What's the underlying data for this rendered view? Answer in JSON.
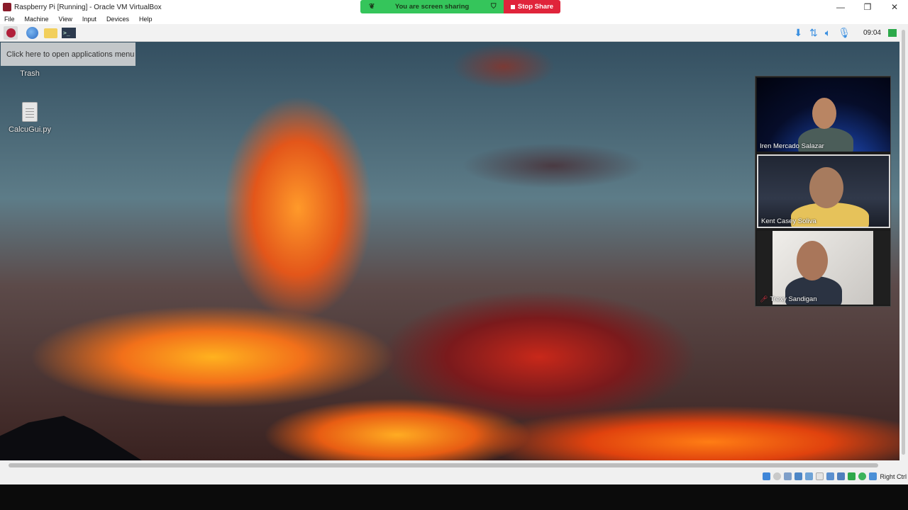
{
  "window": {
    "title": "Raspberry Pi [Running] - Oracle VM VirtualBox",
    "minimize": "—",
    "maximize": "❐",
    "close": "✕"
  },
  "menubar": {
    "items": [
      "File",
      "Machine",
      "View",
      "Input",
      "Devices",
      "Help"
    ]
  },
  "screen_share": {
    "status": "You are screen sharing",
    "stop_label": "Stop Share",
    "colors": {
      "share_bg": "#35c55b",
      "stop_bg": "#e0243b"
    }
  },
  "guest": {
    "taskbar": {
      "launchers": [
        "raspberry-menu-icon",
        "web-browser-icon",
        "file-manager-icon",
        "terminal-icon"
      ],
      "terminal_glyph": ">_",
      "clock": "09:04"
    },
    "tooltip": "Click here to open applications menu",
    "desktop_icons": [
      {
        "label": "Trash",
        "icon": "trash-icon"
      },
      {
        "label": "CalcuGui.py",
        "icon": "python-file-icon"
      }
    ]
  },
  "meeting": {
    "participants": [
      {
        "name": "Iren Mercado Salazar",
        "muted": false
      },
      {
        "name": "Kent Casey Soliva",
        "muted": false,
        "active": true
      },
      {
        "name": "Trexy Sandigan",
        "muted": true
      }
    ]
  },
  "statusbar": {
    "host_key": "Right Ctrl"
  }
}
